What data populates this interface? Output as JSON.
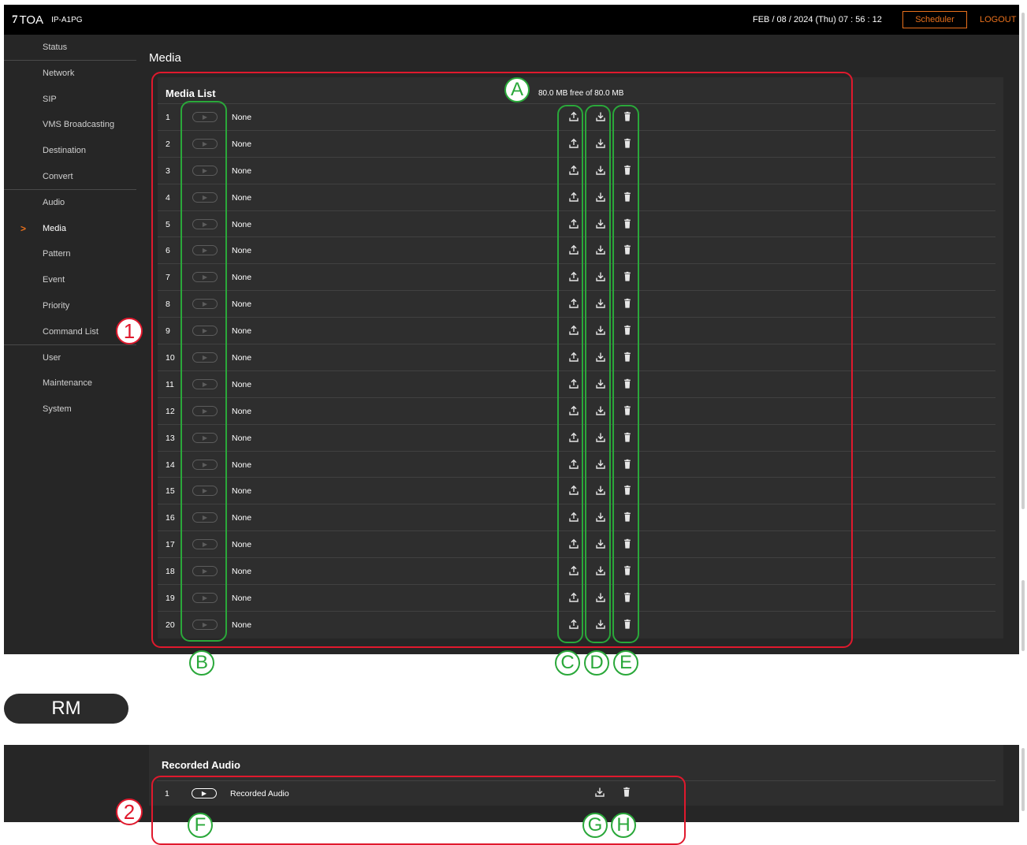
{
  "header": {
    "logo_mark": "7",
    "brand": "TOA",
    "model": "IP-A1PG",
    "datetime": "FEB / 08 / 2024 (Thu)   07 : 56 : 12",
    "scheduler_label": "Scheduler",
    "logout_label": "LOGOUT"
  },
  "sidebar": {
    "items": [
      {
        "label": "Status"
      },
      {
        "label": "Network"
      },
      {
        "label": "SIP"
      },
      {
        "label": "VMS Broadcasting"
      },
      {
        "label": "Destination"
      },
      {
        "label": "Convert"
      },
      {
        "label": "Audio"
      },
      {
        "label": "Media",
        "active": true
      },
      {
        "label": "Pattern"
      },
      {
        "label": "Event"
      },
      {
        "label": "Priority"
      },
      {
        "label": "Command List"
      },
      {
        "label": "User"
      },
      {
        "label": "Maintenance"
      },
      {
        "label": "System"
      }
    ],
    "active_marker": ">"
  },
  "page_title": "Media",
  "media_list": {
    "title": "Media List",
    "capacity": "80.0 MB free of 80.0 MB",
    "rows": [
      {
        "num": "1",
        "name": "None"
      },
      {
        "num": "2",
        "name": "None"
      },
      {
        "num": "3",
        "name": "None"
      },
      {
        "num": "4",
        "name": "None"
      },
      {
        "num": "5",
        "name": "None"
      },
      {
        "num": "6",
        "name": "None"
      },
      {
        "num": "7",
        "name": "None"
      },
      {
        "num": "8",
        "name": "None"
      },
      {
        "num": "9",
        "name": "None"
      },
      {
        "num": "10",
        "name": "None"
      },
      {
        "num": "11",
        "name": "None"
      },
      {
        "num": "12",
        "name": "None"
      },
      {
        "num": "13",
        "name": "None"
      },
      {
        "num": "14",
        "name": "None"
      },
      {
        "num": "15",
        "name": "None"
      },
      {
        "num": "16",
        "name": "None"
      },
      {
        "num": "17",
        "name": "None"
      },
      {
        "num": "18",
        "name": "None"
      },
      {
        "num": "19",
        "name": "None"
      },
      {
        "num": "20",
        "name": "None"
      }
    ],
    "play_glyph": "▶"
  },
  "annotations": {
    "one": "1",
    "two": "2",
    "A": "A",
    "B": "B",
    "C": "C",
    "D": "D",
    "E": "E",
    "F": "F",
    "G": "G",
    "H": "H"
  },
  "rm_label": "RM",
  "recorded": {
    "title": "Recorded Audio",
    "rows": [
      {
        "num": "1",
        "name": "Recorded Audio"
      }
    ]
  },
  "colors": {
    "accent": "#e8701c",
    "callout_red": "#e0192d",
    "callout_green": "#2aa83a",
    "background": "#262626",
    "panel": "#2e2e2e"
  },
  "icons": {
    "upload": "upload-icon",
    "download": "download-icon",
    "delete": "trash-icon",
    "play": "play-icon"
  }
}
